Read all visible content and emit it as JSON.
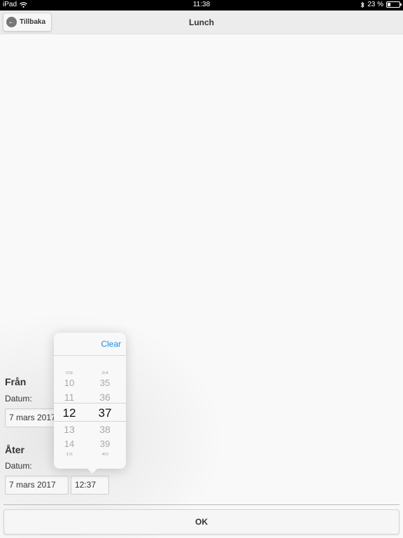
{
  "status_bar": {
    "device": "iPad",
    "time": "11:38",
    "battery_text": "23 %",
    "battery_level": 0.23
  },
  "header": {
    "back_label": "Tillbaka",
    "title": "Lunch"
  },
  "form": {
    "from": {
      "section": "Från",
      "date_label": "Datum:",
      "date_value": "7 mars 2017"
    },
    "to": {
      "section": "Åter",
      "date_label": "Datum:",
      "date_value": "7 mars 2017",
      "time_value": "12:37"
    }
  },
  "picker": {
    "clear_label": "Clear",
    "hours": [
      "09",
      "10",
      "11",
      "12",
      "13",
      "14",
      "15"
    ],
    "minutes": [
      "34",
      "35",
      "36",
      "37",
      "38",
      "39",
      "40"
    ],
    "selected_index": 3
  },
  "footer": {
    "ok_label": "OK"
  },
  "colors": {
    "accent": "#1a8de0",
    "header_bg": "#ececec",
    "status_bg": "#000000"
  }
}
